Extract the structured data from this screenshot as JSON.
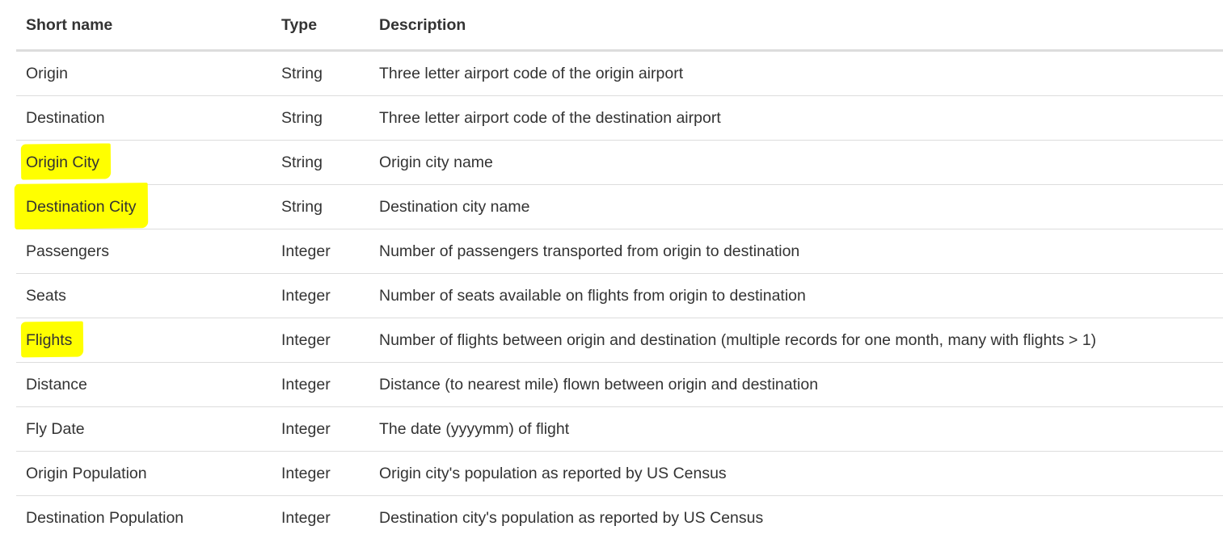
{
  "table": {
    "headers": [
      "Short name",
      "Type",
      "Description"
    ],
    "highlight_color": "#ffff00",
    "rows": [
      {
        "name": "Origin",
        "type": "String",
        "description": "Three letter airport code of the origin airport",
        "highlighted": false
      },
      {
        "name": "Destination",
        "type": "String",
        "description": "Three letter airport code of the destination airport",
        "highlighted": false
      },
      {
        "name": "Origin City",
        "type": "String",
        "description": "Origin city name",
        "highlighted": true
      },
      {
        "name": "Destination City",
        "type": "String",
        "description": "Destination city name",
        "highlighted": true
      },
      {
        "name": "Passengers",
        "type": "Integer",
        "description": "Number of passengers transported from origin to destination",
        "highlighted": false
      },
      {
        "name": "Seats",
        "type": "Integer",
        "description": "Number of seats available on flights from origin to destination",
        "highlighted": false
      },
      {
        "name": "Flights",
        "type": "Integer",
        "description": "Number of flights between origin and destination (multiple records for one month, many with flights > 1)",
        "highlighted": true
      },
      {
        "name": "Distance",
        "type": "Integer",
        "description": "Distance (to nearest mile) flown between origin and destination",
        "highlighted": false
      },
      {
        "name": "Fly Date",
        "type": "Integer",
        "description": "The date (yyyymm) of flight",
        "highlighted": false
      },
      {
        "name": "Origin Population",
        "type": "Integer",
        "description": "Origin city's population as reported by US Census",
        "highlighted": false
      },
      {
        "name": "Destination Population",
        "type": "Integer",
        "description": "Destination city's population as reported by US Census",
        "highlighted": false
      }
    ]
  }
}
